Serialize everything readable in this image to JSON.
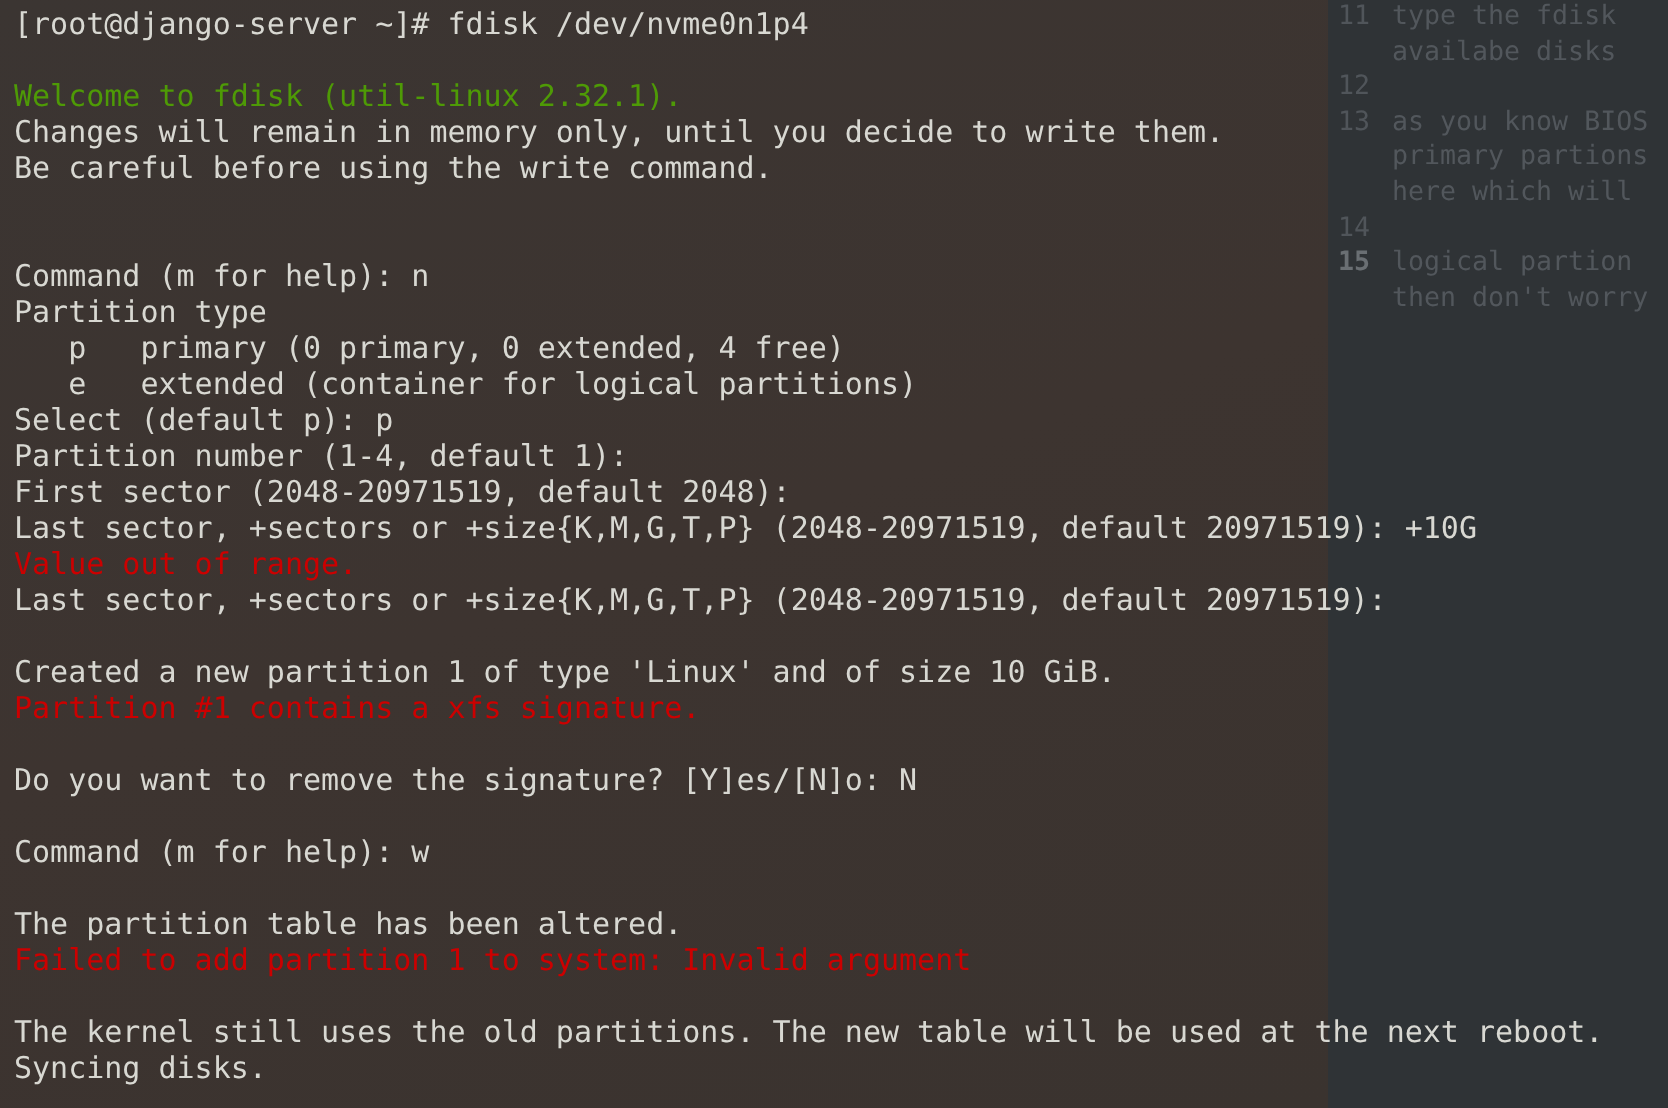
{
  "terminal": {
    "lines": [
      {
        "kind": "normal",
        "text": "[root@django-server ~]# fdisk /dev/nvme0n1p4"
      },
      {
        "kind": "blank"
      },
      {
        "kind": "success",
        "text": "Welcome to fdisk (util-linux 2.32.1)."
      },
      {
        "kind": "normal",
        "text": "Changes will remain in memory only, until you decide to write them."
      },
      {
        "kind": "normal",
        "text": "Be careful before using the write command."
      },
      {
        "kind": "blank"
      },
      {
        "kind": "blank"
      },
      {
        "kind": "normal",
        "text": "Command (m for help): n"
      },
      {
        "kind": "normal",
        "text": "Partition type"
      },
      {
        "kind": "normal",
        "text": "   p   primary (0 primary, 0 extended, 4 free)"
      },
      {
        "kind": "normal",
        "text": "   e   extended (container for logical partitions)"
      },
      {
        "kind": "normal",
        "text": "Select (default p): p"
      },
      {
        "kind": "normal",
        "text": "Partition number (1-4, default 1):"
      },
      {
        "kind": "normal",
        "text": "First sector (2048-20971519, default 2048):"
      },
      {
        "kind": "normal",
        "text": "Last sector, +sectors or +size{K,M,G,T,P} (2048-20971519, default 20971519): +10G"
      },
      {
        "kind": "error",
        "text": "Value out of range."
      },
      {
        "kind": "normal",
        "text": "Last sector, +sectors or +size{K,M,G,T,P} (2048-20971519, default 20971519):"
      },
      {
        "kind": "blank"
      },
      {
        "kind": "normal",
        "text": "Created a new partition 1 of type 'Linux' and of size 10 GiB."
      },
      {
        "kind": "error",
        "text": "Partition #1 contains a xfs signature."
      },
      {
        "kind": "blank"
      },
      {
        "kind": "normal",
        "text": "Do you want to remove the signature? [Y]es/[N]o: N"
      },
      {
        "kind": "blank"
      },
      {
        "kind": "normal",
        "text": "Command (m for help): w"
      },
      {
        "kind": "blank"
      },
      {
        "kind": "normal",
        "text": "The partition table has been altered."
      },
      {
        "kind": "error",
        "text": "Failed to add partition 1 to system: Invalid argument"
      },
      {
        "kind": "blank"
      },
      {
        "kind": "normal",
        "text": "The kernel still uses the old partitions. The new table will be used at the next reboot."
      },
      {
        "kind": "normal",
        "text": "Syncing disks."
      }
    ]
  },
  "editor": {
    "lines": [
      {
        "number": "11",
        "current": false,
        "text": [
          "type the fdisk",
          "availabe disks"
        ]
      },
      {
        "number": "12",
        "current": false
      },
      {
        "number": "13",
        "current": false,
        "text": [
          "as you know BIOS",
          "primary partions",
          "here which will"
        ]
      },
      {
        "number": "14",
        "current": false
      },
      {
        "number": "15",
        "current": true,
        "text": [
          "logical partion",
          "then don't worry"
        ]
      }
    ]
  }
}
